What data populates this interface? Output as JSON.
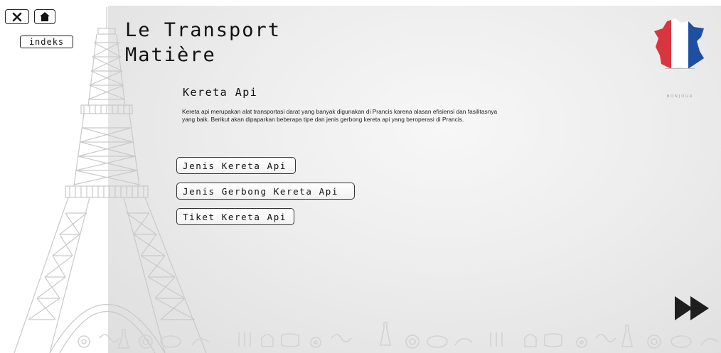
{
  "toolbar": {
    "close_icon": "close-icon",
    "home_icon": "home-icon",
    "index_label": "indeks"
  },
  "header": {
    "title_line1": "Le Transport",
    "title_line2": "Matière"
  },
  "branding": {
    "flag_icon": "france-map-flag",
    "flag_caption": "BONJOUR",
    "colors": {
      "blue": "#1d4fa3",
      "red": "#d9353f",
      "white": "#ffffff"
    }
  },
  "section": {
    "heading": "Kereta Api",
    "body": "Kereta api merupakan alat transportasi darat yang banyak digunakan di Prancis karena alasan efisiensi dan fasilitasnya yang baik. Berikut akan dipaparkan beberapa tipe dan jenis gerbong kereta api yang beroperasi di Prancis."
  },
  "menu": {
    "items": [
      {
        "label": "Jenis Kereta Api"
      },
      {
        "label": "Jenis Gerbong Kereta Api"
      },
      {
        "label": "Tiket Kereta Api"
      }
    ]
  },
  "navigation": {
    "next_icon": "next-arrow-icon"
  },
  "decorations": {
    "background_icon": "eiffel-tower-illustration",
    "footer_icon": "food-pattern-strip"
  }
}
